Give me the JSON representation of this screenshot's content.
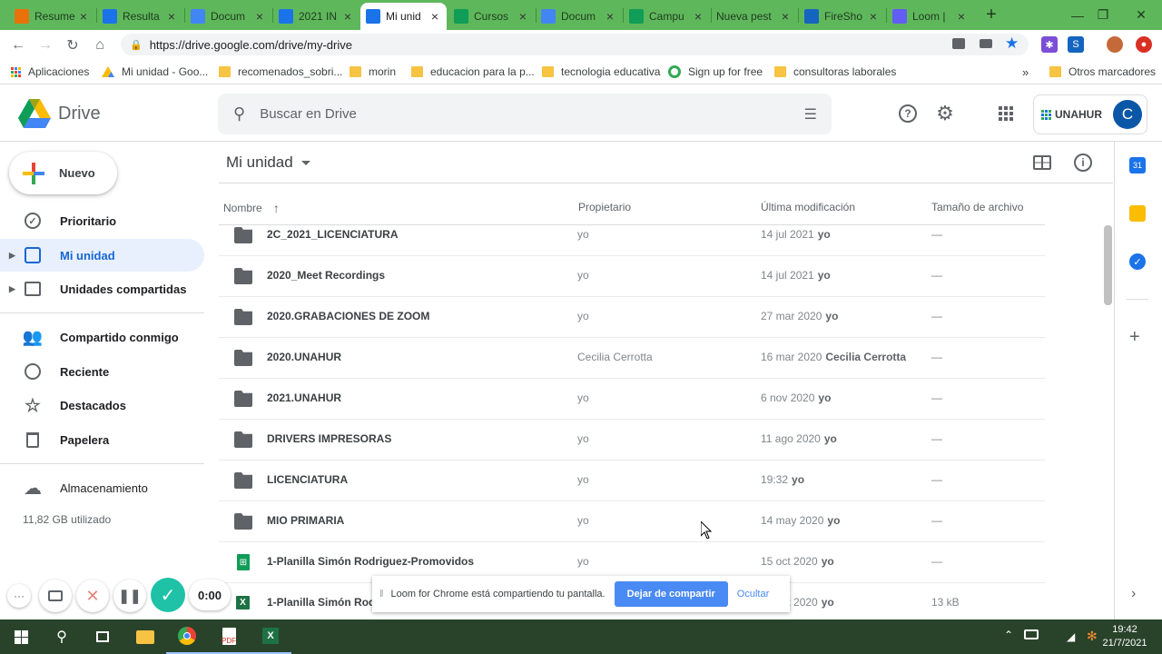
{
  "tabs": [
    {
      "label": "Resume",
      "icon": "10h-icon",
      "color": "#e8710a"
    },
    {
      "label": "Resulta",
      "icon": "drive-icon",
      "color": "#1a73e8"
    },
    {
      "label": "Docum",
      "icon": "docs-icon",
      "color": "#4285f4"
    },
    {
      "label": "2021 IN",
      "icon": "drive-icon",
      "color": "#1a73e8"
    },
    {
      "label": "Mi unid",
      "icon": "drive-icon",
      "color": "#1a73e8",
      "active": true
    },
    {
      "label": "Cursos",
      "icon": "sheets-icon",
      "color": "#0f9d58"
    },
    {
      "label": "Docum",
      "icon": "docs-icon",
      "color": "#4285f4"
    },
    {
      "label": "Campu",
      "icon": "sheets-icon",
      "color": "#0f9d58"
    },
    {
      "label": "Nueva pest",
      "icon": "none",
      "color": "#5fb75b"
    },
    {
      "label": "FireSho",
      "icon": "fireshot-icon",
      "color": "#1565c0"
    },
    {
      "label": "Loom |",
      "icon": "loom-icon",
      "color": "#625df5"
    }
  ],
  "address": {
    "url": "https://drive.google.com/drive/my-drive"
  },
  "bookmarks": [
    {
      "label": "Aplicaciones"
    },
    {
      "label": "Mi unidad - Goo..."
    },
    {
      "label": "recomenados_sobri..."
    },
    {
      "label": "morin"
    },
    {
      "label": "educacion para la p..."
    },
    {
      "label": "tecnologia educativa"
    },
    {
      "label": "Sign up for free"
    },
    {
      "label": "consultoras laborales"
    },
    {
      "label": "Otros marcadores"
    }
  ],
  "drive": {
    "logo_label": "Drive",
    "search_placeholder": "Buscar en Drive",
    "org_label": "UNAHUR",
    "avatar_letter": "C",
    "new_label": "Nuevo",
    "title": "Mi unidad"
  },
  "sidebar": {
    "items": [
      {
        "label": "Prioritario"
      },
      {
        "label": "Mi unidad"
      },
      {
        "label": "Unidades compartidas"
      },
      {
        "label": "Compartido conmigo"
      },
      {
        "label": "Reciente"
      },
      {
        "label": "Destacados"
      },
      {
        "label": "Papelera"
      },
      {
        "label": "Almacenamiento"
      }
    ],
    "storage_used": "11,82 GB utilizado"
  },
  "columns": {
    "name": "Nombre",
    "owner": "Propietario",
    "modified": "Última modificación",
    "size": "Tamaño de archivo"
  },
  "files": [
    {
      "name": "2C_2021_LICENCIATURA",
      "owner": "yo",
      "date": "14 jul 2021",
      "by": "yo",
      "size": "—",
      "type": "folder"
    },
    {
      "name": "2020_Meet Recordings",
      "owner": "yo",
      "date": "14 jul 2021",
      "by": "yo",
      "size": "—",
      "type": "folder"
    },
    {
      "name": "2020.GRABACIONES DE ZOOM",
      "owner": "yo",
      "date": "27 mar 2020",
      "by": "yo",
      "size": "—",
      "type": "folder"
    },
    {
      "name": "2020.UNAHUR",
      "owner": "Cecilia Cerrotta",
      "date": "16 mar 2020",
      "by": "Cecilia Cerrotta",
      "size": "—",
      "type": "shared-folder"
    },
    {
      "name": "2021.UNAHUR",
      "owner": "yo",
      "date": "6 nov 2020",
      "by": "yo",
      "size": "—",
      "type": "folder"
    },
    {
      "name": "DRIVERS IMPRESORAS",
      "owner": "yo",
      "date": "11 ago 2020",
      "by": "yo",
      "size": "—",
      "type": "folder"
    },
    {
      "name": "LICENCIATURA",
      "owner": "yo",
      "date": "19:32",
      "by": "yo",
      "size": "—",
      "type": "folder"
    },
    {
      "name": "MIO PRIMARIA",
      "owner": "yo",
      "date": "14 may 2020",
      "by": "yo",
      "size": "—",
      "type": "folder"
    },
    {
      "name": "1-Planilla Simón Rodriguez-Promovidos",
      "owner": "yo",
      "date": "15 oct 2020",
      "by": "yo",
      "size": "—",
      "type": "sheet"
    },
    {
      "name": "1-Planilla Simón Rodriguez-Promovidos.xlsx",
      "owner": "yo",
      "date": "15 oct 2020",
      "by": "yo",
      "size": "13 kB",
      "type": "excel"
    }
  ],
  "loom": {
    "message": "Loom for Chrome está compartiendo tu pantalla.",
    "stop_label": "Dejar de compartir",
    "hide_label": "Ocultar",
    "timer": "0:00"
  },
  "taskbar": {
    "time": "19:42",
    "date": "21/7/2021"
  }
}
